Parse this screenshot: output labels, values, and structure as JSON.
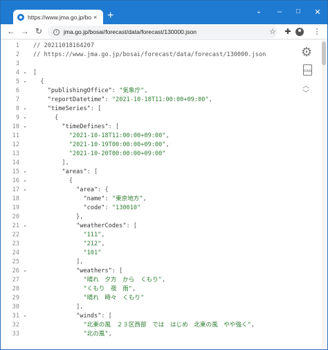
{
  "browser": {
    "tab_title": "https://www.jma.go.jp/bosai/fore",
    "tab_close": "×",
    "new_tab": "+",
    "url": "jma.go.jp/bosai/forecast/data/forecast/130000.json",
    "window_controls": {
      "chevron": "⌄",
      "minimize": "–",
      "maximize": "□",
      "close": "✕"
    },
    "nav": {
      "back": "←",
      "forward": "→",
      "reload": "↻"
    },
    "toolbar_icons": {
      "star": "☆",
      "extensions": "✚",
      "menu": "⋮"
    }
  },
  "viewer": {
    "side_icons": {
      "settings": "⚙",
      "raw_label": "RAW",
      "up": "︿",
      "down": "﹀"
    },
    "lines": [
      {
        "n": "1",
        "fold": "",
        "text": "// 20211018164207"
      },
      {
        "n": "2",
        "fold": "",
        "text": "// https://www.jma.go.jp/bosai/forecast/data/forecast/130000.json"
      },
      {
        "n": "3",
        "fold": "",
        "text": ""
      },
      {
        "n": "4",
        "fold": "▾",
        "text": "["
      },
      {
        "n": "5",
        "fold": "▾",
        "text": "  {"
      },
      {
        "n": "6",
        "fold": "",
        "text": "    \"publishingOffice\": \"気象庁\","
      },
      {
        "n": "7",
        "fold": "",
        "text": "    \"reportDatetime\": \"2021-10-18T11:00:00+09:00\","
      },
      {
        "n": "8",
        "fold": "▾",
        "text": "    \"timeSeries\": ["
      },
      {
        "n": "9",
        "fold": "▾",
        "text": "      {"
      },
      {
        "n": "10",
        "fold": "▾",
        "text": "        \"timeDefines\": ["
      },
      {
        "n": "11",
        "fold": "",
        "text": "          \"2021-10-18T11:00:00+09:00\","
      },
      {
        "n": "12",
        "fold": "",
        "text": "          \"2021-10-19T00:00:00+09:00\","
      },
      {
        "n": "13",
        "fold": "",
        "text": "          \"2021-10-20T00:00:00+09:00\""
      },
      {
        "n": "14",
        "fold": "",
        "text": "        ],"
      },
      {
        "n": "15",
        "fold": "▾",
        "text": "        \"areas\": ["
      },
      {
        "n": "16",
        "fold": "▾",
        "text": "          {"
      },
      {
        "n": "17",
        "fold": "▾",
        "text": "            \"area\": {"
      },
      {
        "n": "18",
        "fold": "",
        "text": "              \"name\": \"東京地方\","
      },
      {
        "n": "19",
        "fold": "",
        "text": "              \"code\": \"130010\""
      },
      {
        "n": "20",
        "fold": "",
        "text": "            },"
      },
      {
        "n": "21",
        "fold": "▾",
        "text": "            \"weatherCodes\": ["
      },
      {
        "n": "22",
        "fold": "",
        "text": "              \"111\","
      },
      {
        "n": "23",
        "fold": "",
        "text": "              \"212\","
      },
      {
        "n": "24",
        "fold": "",
        "text": "              \"101\""
      },
      {
        "n": "25",
        "fold": "",
        "text": "            ],"
      },
      {
        "n": "26",
        "fold": "▾",
        "text": "            \"weathers\": ["
      },
      {
        "n": "27",
        "fold": "",
        "text": "              \"晴れ　夕方　から　くもり\","
      },
      {
        "n": "28",
        "fold": "",
        "text": "              \"くもり　夜　雨\","
      },
      {
        "n": "29",
        "fold": "",
        "text": "              \"晴れ　時々　くもり\""
      },
      {
        "n": "30",
        "fold": "",
        "text": "            ],"
      },
      {
        "n": "31",
        "fold": "▾",
        "text": "            \"winds\": ["
      },
      {
        "n": "32",
        "fold": "",
        "text": "              \"北東の風　２３区西部　では　はじめ　北東の風　やや強く\","
      },
      {
        "n": "33",
        "fold": "",
        "text": "              \"北の風\","
      }
    ]
  }
}
